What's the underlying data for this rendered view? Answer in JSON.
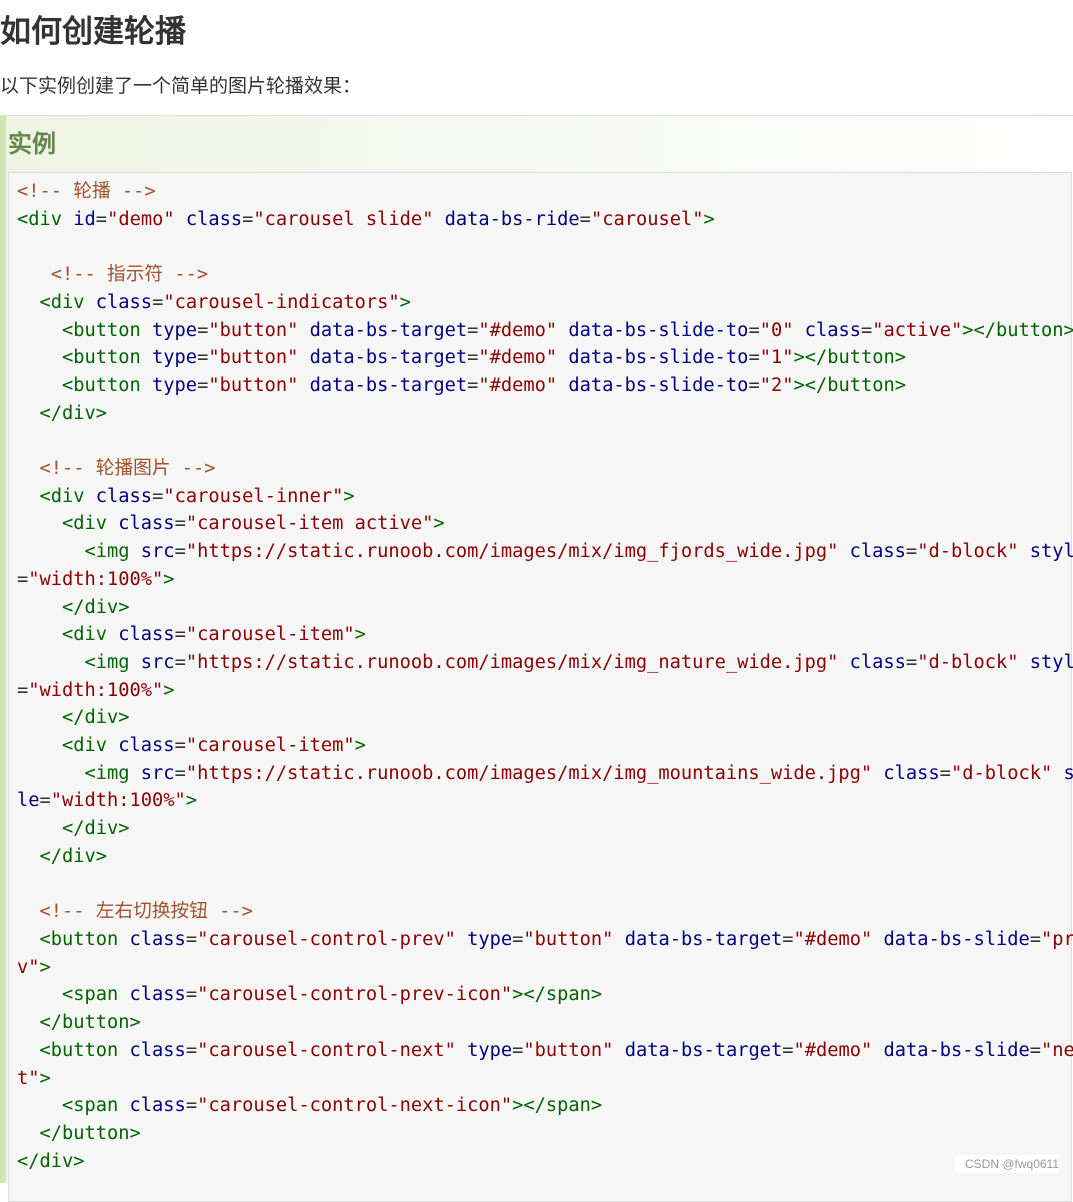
{
  "page": {
    "title": "如何创建轮播",
    "intro": "以下实例创建了一个简单的图片轮播效果："
  },
  "example": {
    "heading": "实例",
    "code_lines": [
      [
        [
          "c",
          "<!-- 轮播 -->"
        ]
      ],
      [
        [
          "t",
          "<div"
        ],
        [
          "o",
          " "
        ],
        [
          "a",
          "id"
        ],
        [
          "o",
          "="
        ],
        [
          "v",
          "\"demo\""
        ],
        [
          "o",
          " "
        ],
        [
          "a",
          "class"
        ],
        [
          "o",
          "="
        ],
        [
          "v",
          "\"carousel slide\""
        ],
        [
          "o",
          " "
        ],
        [
          "a",
          "data-bs-ride"
        ],
        [
          "o",
          "="
        ],
        [
          "v",
          "\"carousel\""
        ],
        [
          "t",
          ">"
        ]
      ],
      [],
      [
        [
          "o",
          "   "
        ],
        [
          "c",
          "<!-- 指示符 -->"
        ]
      ],
      [
        [
          "o",
          "  "
        ],
        [
          "t",
          "<div"
        ],
        [
          "o",
          " "
        ],
        [
          "a",
          "class"
        ],
        [
          "o",
          "="
        ],
        [
          "v",
          "\"carousel-indicators\""
        ],
        [
          "t",
          ">"
        ]
      ],
      [
        [
          "o",
          "    "
        ],
        [
          "t",
          "<button"
        ],
        [
          "o",
          " "
        ],
        [
          "a",
          "type"
        ],
        [
          "o",
          "="
        ],
        [
          "v",
          "\"button\""
        ],
        [
          "o",
          " "
        ],
        [
          "a",
          "data-bs-target"
        ],
        [
          "o",
          "="
        ],
        [
          "v",
          "\"#demo\""
        ],
        [
          "o",
          " "
        ],
        [
          "a",
          "data-bs-slide-to"
        ],
        [
          "o",
          "="
        ],
        [
          "v",
          "\"0\""
        ],
        [
          "o",
          " "
        ],
        [
          "a",
          "class"
        ],
        [
          "o",
          "="
        ],
        [
          "v",
          "\"active\""
        ],
        [
          "t",
          "></button>"
        ]
      ],
      [
        [
          "o",
          "    "
        ],
        [
          "t",
          "<button"
        ],
        [
          "o",
          " "
        ],
        [
          "a",
          "type"
        ],
        [
          "o",
          "="
        ],
        [
          "v",
          "\"button\""
        ],
        [
          "o",
          " "
        ],
        [
          "a",
          "data-bs-target"
        ],
        [
          "o",
          "="
        ],
        [
          "v",
          "\"#demo\""
        ],
        [
          "o",
          " "
        ],
        [
          "a",
          "data-bs-slide-to"
        ],
        [
          "o",
          "="
        ],
        [
          "v",
          "\"1\""
        ],
        [
          "t",
          "></button>"
        ]
      ],
      [
        [
          "o",
          "    "
        ],
        [
          "t",
          "<button"
        ],
        [
          "o",
          " "
        ],
        [
          "a",
          "type"
        ],
        [
          "o",
          "="
        ],
        [
          "v",
          "\"button\""
        ],
        [
          "o",
          " "
        ],
        [
          "a",
          "data-bs-target"
        ],
        [
          "o",
          "="
        ],
        [
          "v",
          "\"#demo\""
        ],
        [
          "o",
          " "
        ],
        [
          "a",
          "data-bs-slide-to"
        ],
        [
          "o",
          "="
        ],
        [
          "v",
          "\"2\""
        ],
        [
          "t",
          "></button>"
        ]
      ],
      [
        [
          "o",
          "  "
        ],
        [
          "t",
          "</div>"
        ]
      ],
      [],
      [
        [
          "o",
          "  "
        ],
        [
          "c",
          "<!-- 轮播图片 -->"
        ]
      ],
      [
        [
          "o",
          "  "
        ],
        [
          "t",
          "<div"
        ],
        [
          "o",
          " "
        ],
        [
          "a",
          "class"
        ],
        [
          "o",
          "="
        ],
        [
          "v",
          "\"carousel-inner\""
        ],
        [
          "t",
          ">"
        ]
      ],
      [
        [
          "o",
          "    "
        ],
        [
          "t",
          "<div"
        ],
        [
          "o",
          " "
        ],
        [
          "a",
          "class"
        ],
        [
          "o",
          "="
        ],
        [
          "v",
          "\"carousel-item active\""
        ],
        [
          "t",
          ">"
        ]
      ],
      [
        [
          "o",
          "      "
        ],
        [
          "t",
          "<img"
        ],
        [
          "o",
          " "
        ],
        [
          "a",
          "src"
        ],
        [
          "o",
          "="
        ],
        [
          "v",
          "\"https://static.runoob.com/images/mix/img_fjords_wide.jpg\""
        ],
        [
          "o",
          " "
        ],
        [
          "a",
          "class"
        ],
        [
          "o",
          "="
        ],
        [
          "v",
          "\"d-block\""
        ],
        [
          "o",
          " "
        ],
        [
          "a",
          "style"
        ]
      ],
      [
        [
          "o",
          "="
        ],
        [
          "v",
          "\"width:100%\""
        ],
        [
          "t",
          ">"
        ]
      ],
      [
        [
          "o",
          "    "
        ],
        [
          "t",
          "</div>"
        ]
      ],
      [
        [
          "o",
          "    "
        ],
        [
          "t",
          "<div"
        ],
        [
          "o",
          " "
        ],
        [
          "a",
          "class"
        ],
        [
          "o",
          "="
        ],
        [
          "v",
          "\"carousel-item\""
        ],
        [
          "t",
          ">"
        ]
      ],
      [
        [
          "o",
          "      "
        ],
        [
          "t",
          "<img"
        ],
        [
          "o",
          " "
        ],
        [
          "a",
          "src"
        ],
        [
          "o",
          "="
        ],
        [
          "v",
          "\"https://static.runoob.com/images/mix/img_nature_wide.jpg\""
        ],
        [
          "o",
          " "
        ],
        [
          "a",
          "class"
        ],
        [
          "o",
          "="
        ],
        [
          "v",
          "\"d-block\""
        ],
        [
          "o",
          " "
        ],
        [
          "a",
          "style"
        ]
      ],
      [
        [
          "o",
          "="
        ],
        [
          "v",
          "\"width:100%\""
        ],
        [
          "t",
          ">"
        ]
      ],
      [
        [
          "o",
          "    "
        ],
        [
          "t",
          "</div>"
        ]
      ],
      [
        [
          "o",
          "    "
        ],
        [
          "t",
          "<div"
        ],
        [
          "o",
          " "
        ],
        [
          "a",
          "class"
        ],
        [
          "o",
          "="
        ],
        [
          "v",
          "\"carousel-item\""
        ],
        [
          "t",
          ">"
        ]
      ],
      [
        [
          "o",
          "      "
        ],
        [
          "t",
          "<img"
        ],
        [
          "o",
          " "
        ],
        [
          "a",
          "src"
        ],
        [
          "o",
          "="
        ],
        [
          "v",
          "\"https://static.runoob.com/images/mix/img_mountains_wide.jpg\""
        ],
        [
          "o",
          " "
        ],
        [
          "a",
          "class"
        ],
        [
          "o",
          "="
        ],
        [
          "v",
          "\"d-block\""
        ],
        [
          "o",
          " "
        ],
        [
          "a",
          "sty"
        ]
      ],
      [
        [
          "a",
          "le"
        ],
        [
          "o",
          "="
        ],
        [
          "v",
          "\"width:100%\""
        ],
        [
          "t",
          ">"
        ]
      ],
      [
        [
          "o",
          "    "
        ],
        [
          "t",
          "</div>"
        ]
      ],
      [
        [
          "o",
          "  "
        ],
        [
          "t",
          "</div>"
        ]
      ],
      [],
      [
        [
          "o",
          "  "
        ],
        [
          "c",
          "<!-- 左右切换按钮 -->"
        ]
      ],
      [
        [
          "o",
          "  "
        ],
        [
          "t",
          "<button"
        ],
        [
          "o",
          " "
        ],
        [
          "a",
          "class"
        ],
        [
          "o",
          "="
        ],
        [
          "v",
          "\"carousel-control-prev\""
        ],
        [
          "o",
          " "
        ],
        [
          "a",
          "type"
        ],
        [
          "o",
          "="
        ],
        [
          "v",
          "\"button\""
        ],
        [
          "o",
          " "
        ],
        [
          "a",
          "data-bs-target"
        ],
        [
          "o",
          "="
        ],
        [
          "v",
          "\"#demo\""
        ],
        [
          "o",
          " "
        ],
        [
          "a",
          "data-bs-slide"
        ],
        [
          "o",
          "="
        ],
        [
          "v",
          "\"pre"
        ]
      ],
      [
        [
          "v",
          "v\""
        ],
        [
          "t",
          ">"
        ]
      ],
      [
        [
          "o",
          "    "
        ],
        [
          "t",
          "<span"
        ],
        [
          "o",
          " "
        ],
        [
          "a",
          "class"
        ],
        [
          "o",
          "="
        ],
        [
          "v",
          "\"carousel-control-prev-icon\""
        ],
        [
          "t",
          "></span>"
        ]
      ],
      [
        [
          "o",
          "  "
        ],
        [
          "t",
          "</button>"
        ]
      ],
      [
        [
          "o",
          "  "
        ],
        [
          "t",
          "<button"
        ],
        [
          "o",
          " "
        ],
        [
          "a",
          "class"
        ],
        [
          "o",
          "="
        ],
        [
          "v",
          "\"carousel-control-next\""
        ],
        [
          "o",
          " "
        ],
        [
          "a",
          "type"
        ],
        [
          "o",
          "="
        ],
        [
          "v",
          "\"button\""
        ],
        [
          "o",
          " "
        ],
        [
          "a",
          "data-bs-target"
        ],
        [
          "o",
          "="
        ],
        [
          "v",
          "\"#demo\""
        ],
        [
          "o",
          " "
        ],
        [
          "a",
          "data-bs-slide"
        ],
        [
          "o",
          "="
        ],
        [
          "v",
          "\"nex"
        ]
      ],
      [
        [
          "v",
          "t\""
        ],
        [
          "t",
          ">"
        ]
      ],
      [
        [
          "o",
          "    "
        ],
        [
          "t",
          "<span"
        ],
        [
          "o",
          " "
        ],
        [
          "a",
          "class"
        ],
        [
          "o",
          "="
        ],
        [
          "v",
          "\"carousel-control-next-icon\""
        ],
        [
          "t",
          "></span>"
        ]
      ],
      [
        [
          "o",
          "  "
        ],
        [
          "t",
          "</button>"
        ]
      ],
      [
        [
          "t",
          "</div>"
        ]
      ]
    ]
  },
  "watermark": "CSDN @fwq0611"
}
